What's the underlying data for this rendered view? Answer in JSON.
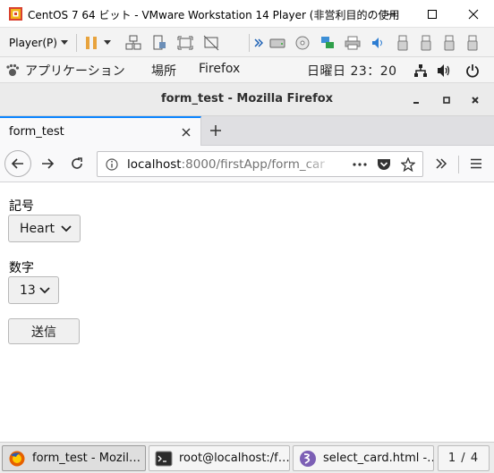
{
  "vmware": {
    "title": "CentOS 7 64 ビット - VMware Workstation 14 Player (非営利目的の使用",
    "player_menu": "Player(P)",
    "toolbar_icons": [
      "pause-icon",
      "dropdown-icon",
      "send-ctrl-alt-del-icon",
      "unity-icon",
      "fullscreen-icon",
      "no-network-icon",
      "more-icon",
      "hard-disk-icon",
      "cd-icon",
      "network-adapter-icon",
      "printer-icon",
      "sound-icon",
      "usb-icon",
      "usb-icon",
      "usb-icon",
      "usb-icon"
    ],
    "colors": {
      "pause": "#e8a33d",
      "logo_red": "#d9412f",
      "logo_yellow": "#f2b416"
    }
  },
  "gnome": {
    "applications": "アプリケーション",
    "places": "場所",
    "app_name": "Firefox",
    "clock": "日曜日 23：20"
  },
  "firefox": {
    "window_title": "form_test - Mozilla Firefox",
    "tab_title": "form_test",
    "url_host": "localhost",
    "url_path": ":8000/firstApp/form_car"
  },
  "page": {
    "symbol_label": "記号",
    "symbol_value": "Heart",
    "number_label": "数字",
    "number_value": "13",
    "submit_label": "送信"
  },
  "taskbar": {
    "items": [
      {
        "label": "form_test - Mozil…",
        "icon": "firefox-icon"
      },
      {
        "label": "root@localhost:/f…",
        "icon": "terminal-icon"
      },
      {
        "label": "select_card.html -…",
        "icon": "emacs-icon"
      }
    ],
    "workspace": "1 / 4"
  }
}
